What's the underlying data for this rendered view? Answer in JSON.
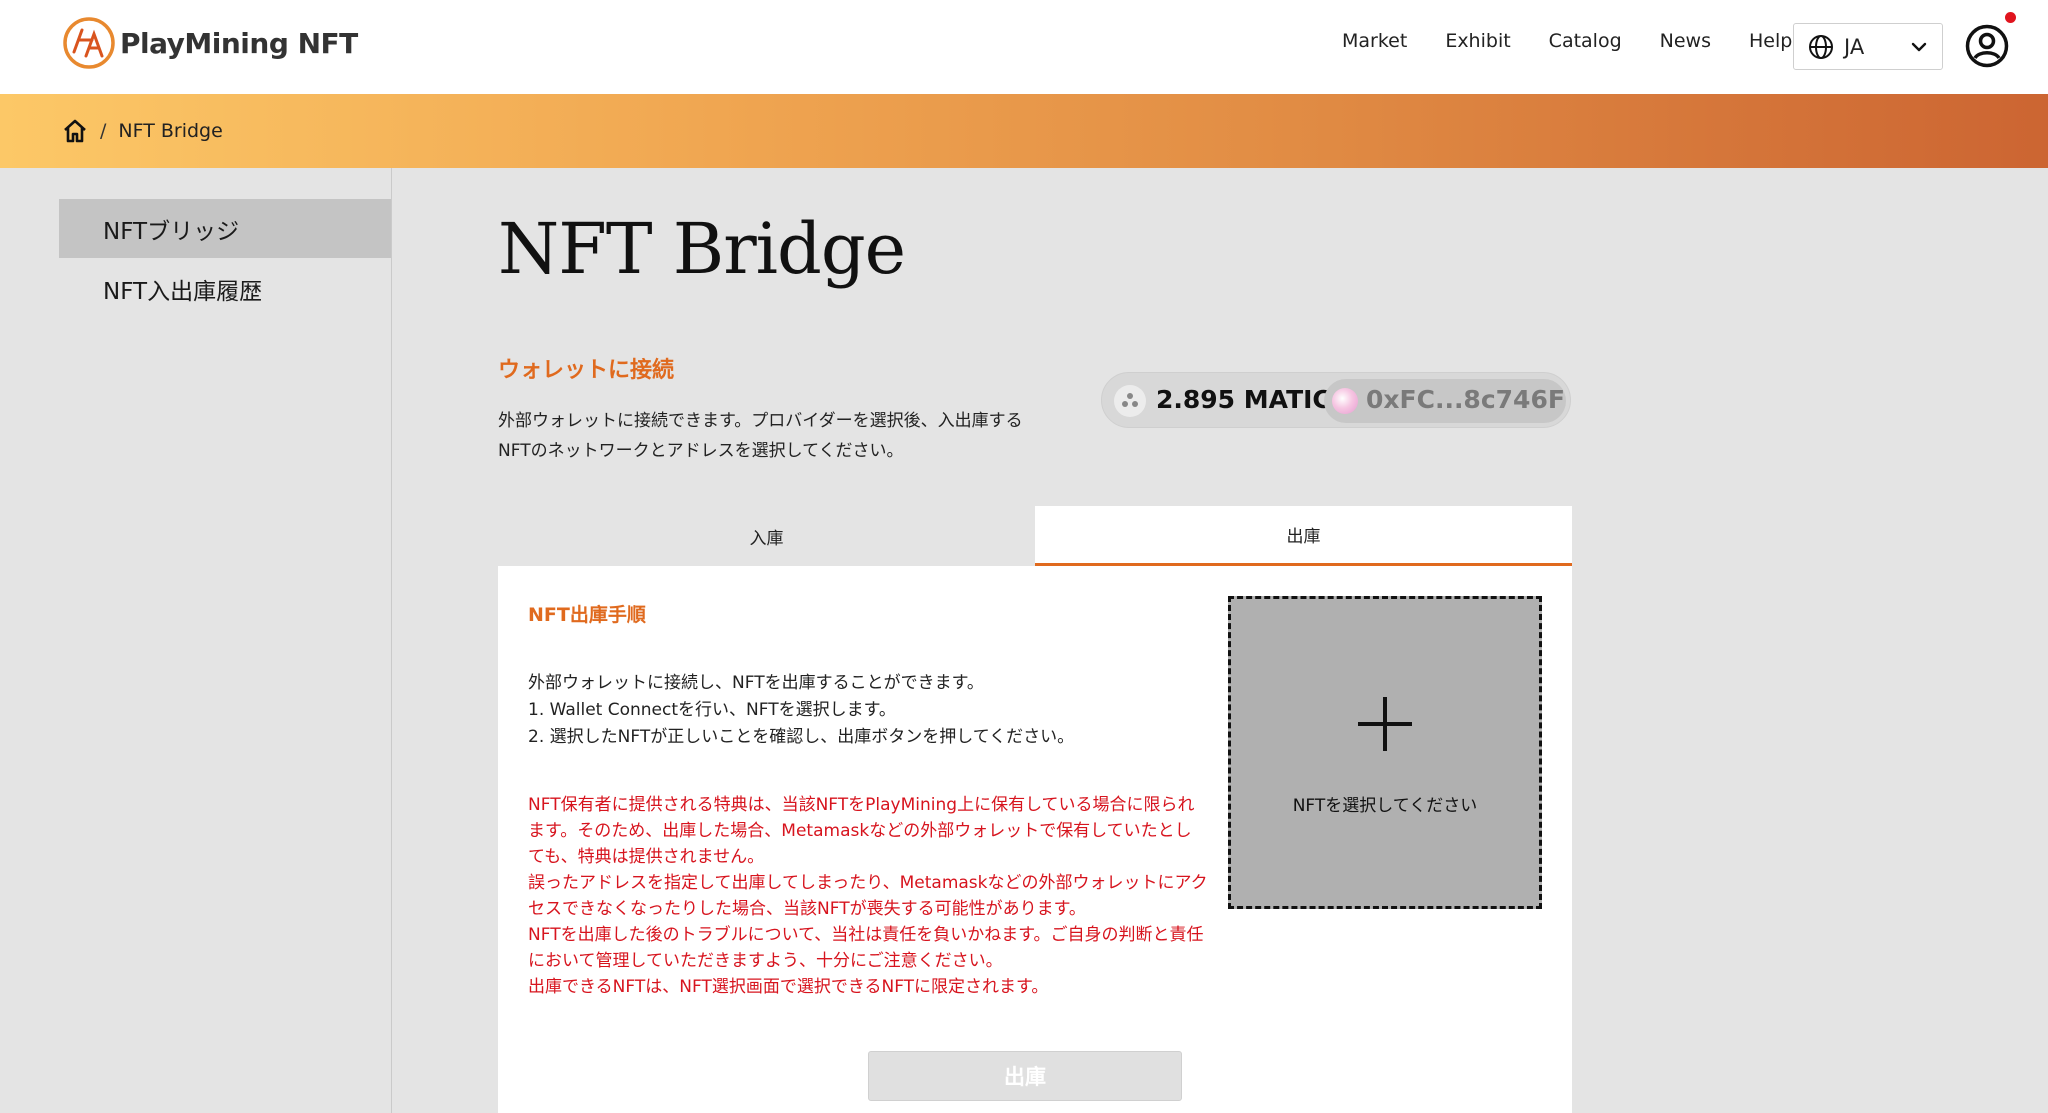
{
  "header": {
    "brand": "PlayMining NFT",
    "nav": [
      "Market",
      "Exhibit",
      "Catalog",
      "News",
      "Help"
    ],
    "language": "JA"
  },
  "breadcrumb": {
    "separator": "/",
    "current": "NFT Bridge"
  },
  "sidebar": {
    "items": [
      {
        "label": "NFTブリッジ",
        "active": true
      },
      {
        "label": "NFT入出庫履歴",
        "active": false
      }
    ]
  },
  "main": {
    "title": "NFT Bridge",
    "wallet_section": {
      "title": "ウォレットに接続",
      "description": "外部ウォレットに接続できます。プロバイダーを選択後、入出庫するNFTのネットワークとアドレスを選択してください。"
    },
    "wallet": {
      "balance": "2.895 MATIC",
      "address": "0xFC...8c746F"
    },
    "tabs": [
      {
        "label": "入庫",
        "active": false
      },
      {
        "label": "出庫",
        "active": true
      }
    ],
    "panel": {
      "steps_title": "NFT出庫手順",
      "steps": [
        "外部ウォレットに接続し、NFTを出庫することができます。",
        "1. Wallet Connectを行い、NFTを選択します。",
        "2. 選択したNFTが正しいことを確認し、出庫ボタンを押してください。"
      ],
      "warnings": [
        "NFT保有者に提供される特典は、当該NFTをPlayMining上に保有している場合に限られます。そのため、出庫した場合、Metamaskなどの外部ウォレットで保有していたとしても、特典は提供されません。",
        "誤ったアドレスを指定して出庫してしまったり、Metamaskなどの外部ウォレットにアクセスできなくなったりした場合、当該NFTが喪失する可能性があります。",
        "NFTを出庫した後のトラブルについて、当社は責任を負いかねます。ご自身の判断と責任において管理していただきますよう、十分にご注意ください。",
        "出庫できるNFTは、NFT選択画面で選択できるNFTに限定されます。"
      ],
      "select_nft_label": "NFTを選択してください",
      "withdraw_button": "出庫"
    }
  },
  "colors": {
    "accent": "#e06a1e",
    "warning": "#d7141e",
    "notification": "#e0141e"
  }
}
